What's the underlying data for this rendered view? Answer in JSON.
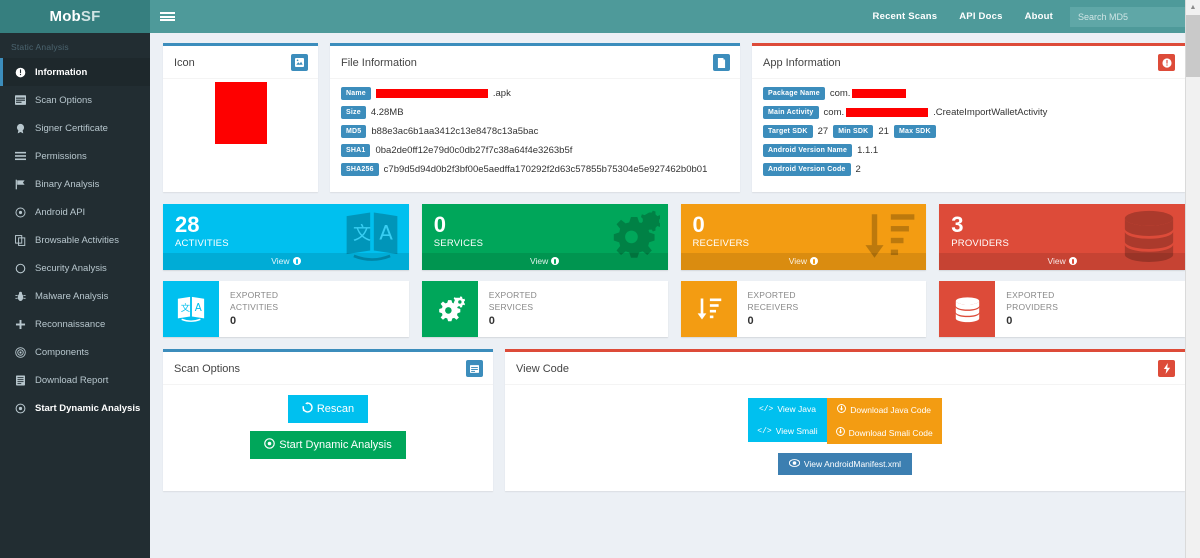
{
  "brand": {
    "part1": "Mob",
    "part2": "SF"
  },
  "topbar": {
    "menu_icon": "hamburger-icon",
    "links": [
      {
        "label": "Recent Scans"
      },
      {
        "label": "API Docs"
      },
      {
        "label": "About"
      }
    ],
    "search_placeholder": "Search MD5",
    "search_value": ""
  },
  "sidebar": {
    "section_label": "Static Analysis",
    "items": [
      {
        "label": "Information",
        "icon": "info-circle-icon",
        "active": true
      },
      {
        "label": "Scan Options",
        "icon": "window-icon",
        "active": false
      },
      {
        "label": "Signer Certificate",
        "icon": "certificate-icon",
        "active": false
      },
      {
        "label": "Permissions",
        "icon": "list-icon",
        "active": false
      },
      {
        "label": "Binary Analysis",
        "icon": "flag-icon",
        "active": false
      },
      {
        "label": "Android API",
        "icon": "target-icon",
        "active": false
      },
      {
        "label": "Browsable Activities",
        "icon": "copy-icon",
        "active": false
      },
      {
        "label": "Security Analysis",
        "icon": "circle-o-icon",
        "active": false
      },
      {
        "label": "Malware Analysis",
        "icon": "bug-icon",
        "active": false
      },
      {
        "label": "Reconnaissance",
        "icon": "plus-icon",
        "active": false
      },
      {
        "label": "Components",
        "icon": "bullseye-icon",
        "active": false
      },
      {
        "label": "Download Report",
        "icon": "file-report-icon",
        "active": false
      },
      {
        "label": "Start Dynamic Analysis",
        "icon": "play-circle-icon",
        "active": false,
        "bold": true
      }
    ]
  },
  "icon_panel": {
    "title": "Icon",
    "header_icon": "image-icon",
    "app_icon_color": "#fe0000"
  },
  "file_information": {
    "title": "File Information",
    "header_icon": "file-icon",
    "fields": [
      {
        "tag": "Name",
        "value": ".apk",
        "redacted": true,
        "redact_width": 112
      },
      {
        "tag": "Size",
        "value": "4.28MB",
        "redacted": false
      },
      {
        "tag": "MD5",
        "value": "b88e3ac6b1aa3412c13e8478c13a5bac",
        "redacted": false
      },
      {
        "tag": "SHA1",
        "value": "0ba2de0ff12e79d0c0db27f7c38a64f4e3263b5f",
        "redacted": false
      },
      {
        "tag": "SHA256",
        "value": "c7b9d5d94d0b2f3bf00e5aedffa170292f2d63c57855b75304e5e927462b0b01",
        "redacted": false
      }
    ]
  },
  "app_information": {
    "title": "App Information",
    "header_icon": "exclamation-circle-icon",
    "fields": [
      {
        "tag": "Package Name",
        "prefix": "com.",
        "redacted": true,
        "redact_width": 54,
        "suffix": ""
      },
      {
        "tag": "Main Activity",
        "prefix": "com.",
        "redacted": true,
        "redact_width": 82,
        "suffix": ".CreateImportWalletActivity"
      },
      {
        "tag": "Android Version Name",
        "prefix": "",
        "redacted": false,
        "suffix": "1.1.1"
      },
      {
        "tag": "Android Version Code",
        "prefix": "",
        "redacted": false,
        "suffix": "2"
      }
    ],
    "sdk": [
      {
        "tag": "Target SDK",
        "value": "27"
      },
      {
        "tag": "Min SDK",
        "value": "21"
      },
      {
        "tag": "Max SDK",
        "value": ""
      }
    ]
  },
  "stat_boxes": [
    {
      "number": "28",
      "label": "ACTIVITIES",
      "view_label": "View",
      "color": "#00c0ef",
      "class": "bg-aqua",
      "icon": "translate-icon"
    },
    {
      "number": "0",
      "label": "SERVICES",
      "view_label": "View",
      "color": "#00a65a",
      "class": "bg-green",
      "icon": "gears-icon"
    },
    {
      "number": "0",
      "label": "RECEIVERS",
      "view_label": "View",
      "color": "#f39c12",
      "class": "bg-yellow",
      "icon": "sort-amount-desc-icon"
    },
    {
      "number": "3",
      "label": "PROVIDERS",
      "view_label": "View",
      "color": "#dd4b39",
      "class": "bg-red",
      "icon": "database-icon"
    }
  ],
  "info_boxes": [
    {
      "line1": "EXPORTED",
      "line2": "ACTIVITIES",
      "number": "0",
      "color": "#00c0ef",
      "icon": "translate-icon"
    },
    {
      "line1": "EXPORTED",
      "line2": "SERVICES",
      "number": "0",
      "color": "#00a65a",
      "icon": "gears-icon"
    },
    {
      "line1": "EXPORTED",
      "line2": "RECEIVERS",
      "number": "0",
      "color": "#f39c12",
      "icon": "sort-amount-desc-icon"
    },
    {
      "line1": "EXPORTED",
      "line2": "PROVIDERS",
      "number": "0",
      "color": "#dd4b39",
      "icon": "database-icon"
    }
  ],
  "scan_options": {
    "title": "Scan Options",
    "header_icon": "window-icon",
    "rescan_label": "Rescan",
    "rescan_icon": "refresh-icon",
    "dynamic_label": "Start Dynamic Analysis",
    "dynamic_icon": "play-circle-icon"
  },
  "view_code": {
    "title": "View Code",
    "header_icon": "bolt-icon",
    "buttons": [
      {
        "label": "View Java",
        "icon": "code-icon",
        "style": "code"
      },
      {
        "label": "Download Java Code",
        "icon": "download-icon",
        "style": "download"
      },
      {
        "label": "View Smali",
        "icon": "code-icon",
        "style": "code"
      },
      {
        "label": "Download Smali Code",
        "icon": "download-icon",
        "style": "download"
      }
    ],
    "manifest_label": "View AndroidManifest.xml",
    "manifest_icon": "eye-icon"
  }
}
